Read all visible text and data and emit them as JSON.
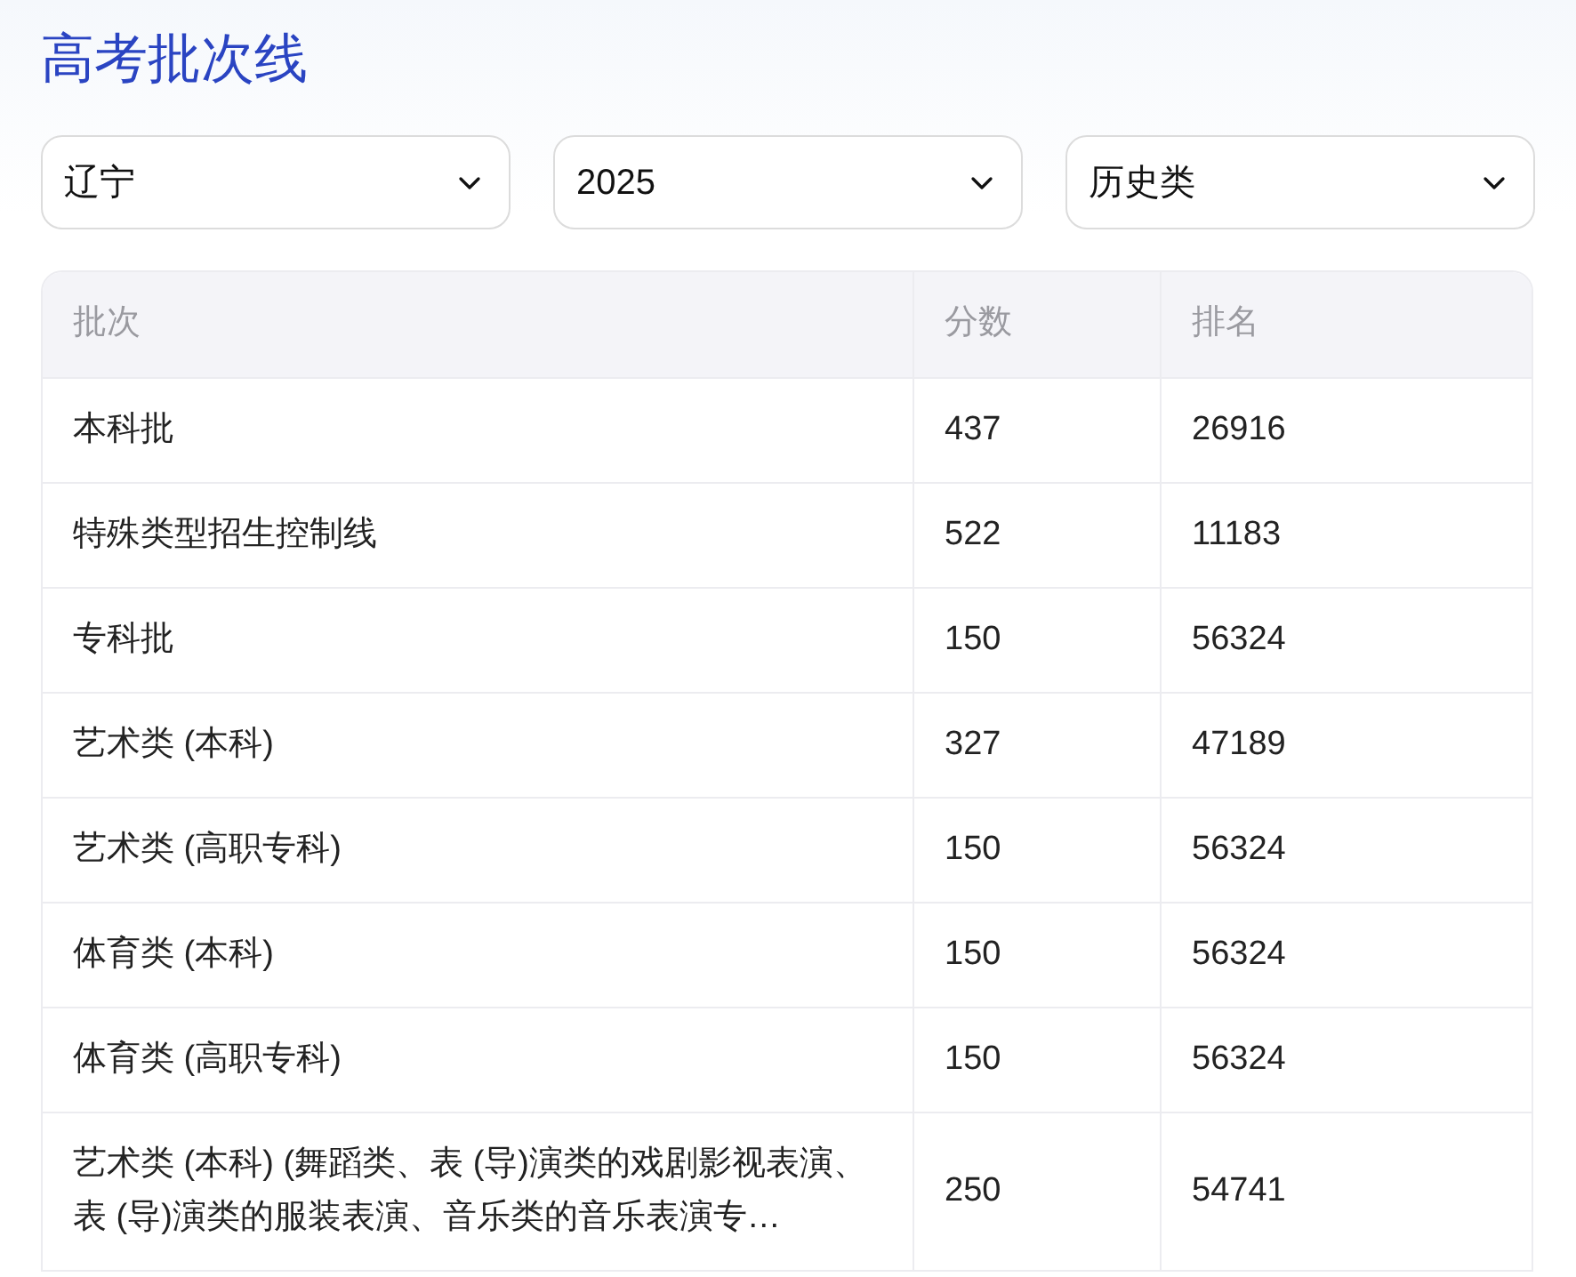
{
  "title": "高考批次线",
  "filters": [
    {
      "value": "辽宁"
    },
    {
      "value": "2025"
    },
    {
      "value": "历史类"
    }
  ],
  "table": {
    "columns": [
      "批次",
      "分数",
      "排名"
    ],
    "rows": [
      [
        "本科批",
        "437",
        "26916"
      ],
      [
        "特殊类型招生控制线",
        "522",
        "11183"
      ],
      [
        "专科批",
        "150",
        "56324"
      ],
      [
        "艺术类 (本科)",
        "327",
        "47189"
      ],
      [
        "艺术类 (高职专科)",
        "150",
        "56324"
      ],
      [
        "体育类 (本科)",
        "150",
        "56324"
      ],
      [
        "体育类 (高职专科)",
        "150",
        "56324"
      ],
      [
        "艺术类 (本科) (舞蹈类、表 (导)演类的戏剧影视表演、表 (导)演类的服装表演、音乐类的音乐表演专…",
        "250",
        "54741"
      ]
    ]
  }
}
